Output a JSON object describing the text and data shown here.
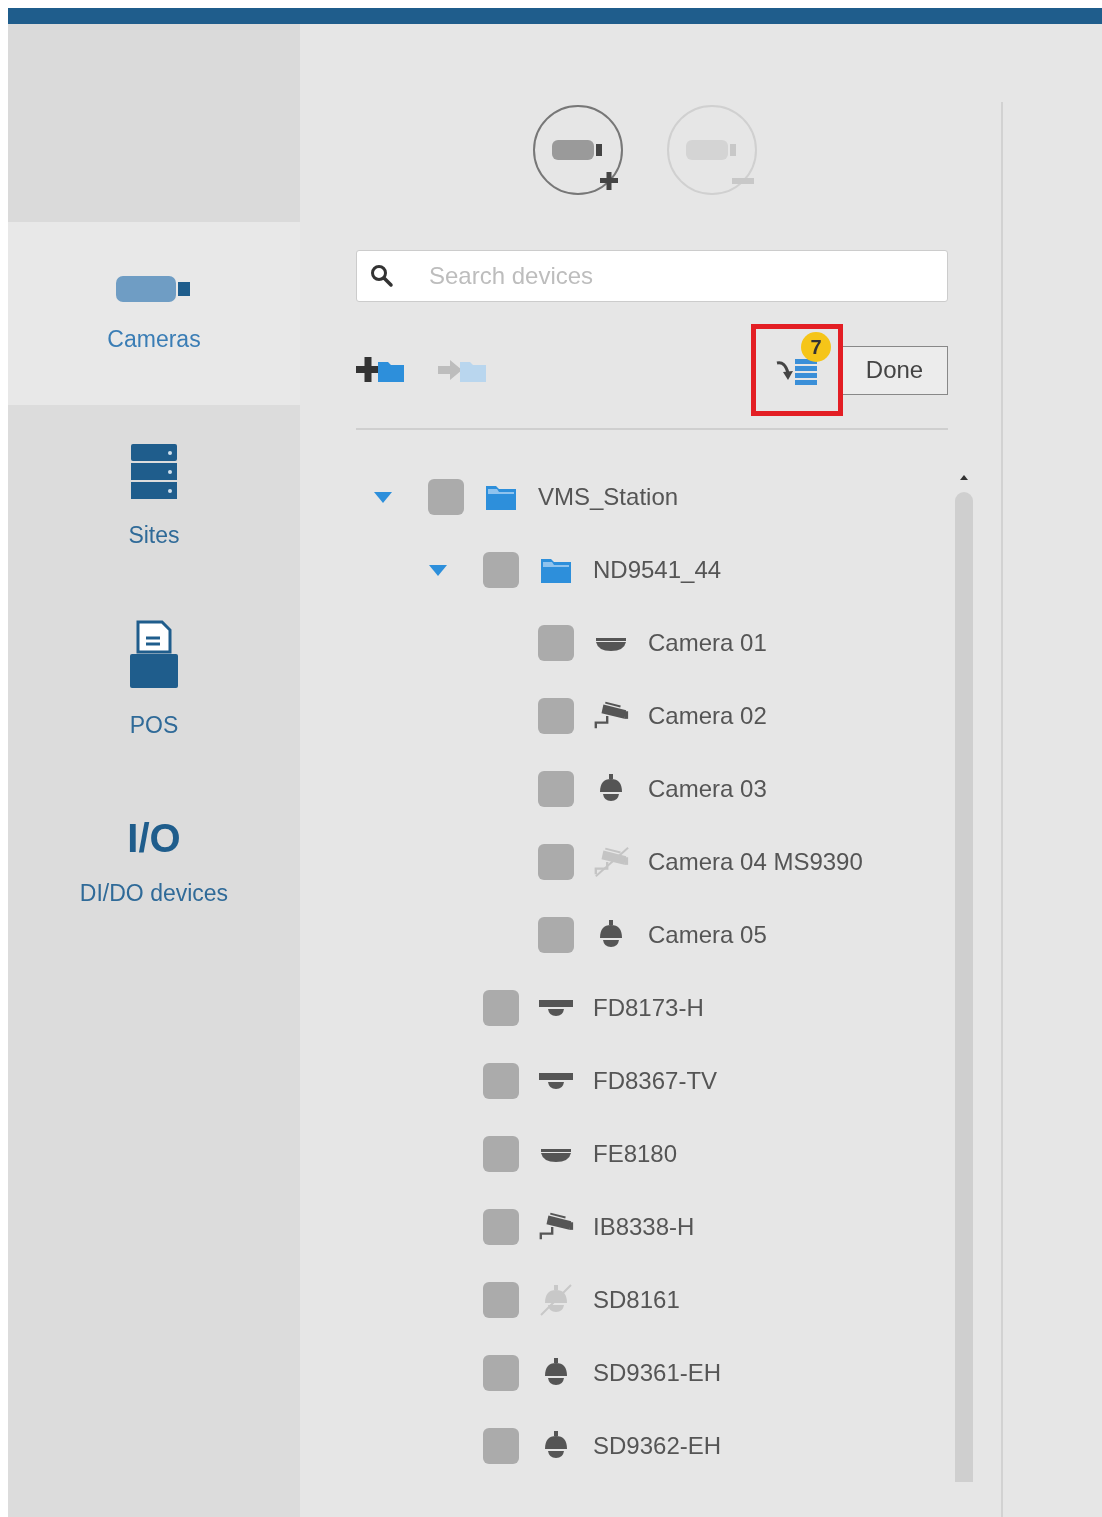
{
  "sidebar": {
    "items": [
      {
        "label": "Cameras",
        "kind": "camera",
        "selected": true
      },
      {
        "label": "Sites",
        "kind": "server",
        "selected": false
      },
      {
        "label": "POS",
        "kind": "pos",
        "selected": false
      },
      {
        "label": "DI/DO devices",
        "kind": "io",
        "glyph": "I/O",
        "selected": false
      }
    ]
  },
  "camera_buttons": [
    {
      "kind": "add",
      "disabled": false
    },
    {
      "kind": "remove",
      "disabled": true
    }
  ],
  "search": {
    "placeholder": "Search devices"
  },
  "toolbar": {
    "tools": [
      {
        "kind": "add-folder",
        "disabled": false
      },
      {
        "kind": "move-to-folder",
        "disabled": true
      }
    ],
    "import_button": {
      "badge": "7",
      "highlighted": true
    },
    "done_button": "Done"
  },
  "tree": [
    {
      "label": "VMS_Station",
      "kind": "folder",
      "expanded": true,
      "checked": false,
      "children": [
        {
          "label": "ND9541_44",
          "kind": "folder",
          "expanded": true,
          "checked": false,
          "children": [
            {
              "label": "Camera 01",
              "kind": "fisheye",
              "checked": false
            },
            {
              "label": "Camera 02",
              "kind": "bullet",
              "checked": false
            },
            {
              "label": "Camera 03",
              "kind": "speed-dome",
              "checked": false
            },
            {
              "label": "Camera 04 MS9390",
              "kind": "bullet-offline",
              "checked": false
            },
            {
              "label": "Camera 05",
              "kind": "speed-dome",
              "checked": false
            }
          ]
        },
        {
          "label": "FD8173-H",
          "kind": "dome",
          "checked": false
        },
        {
          "label": "FD8367-TV",
          "kind": "dome",
          "checked": false
        },
        {
          "label": "FE8180",
          "kind": "fisheye",
          "checked": false
        },
        {
          "label": "IB8338-H",
          "kind": "bullet",
          "checked": false
        },
        {
          "label": "SD8161",
          "kind": "speed-dome-offline",
          "checked": false
        },
        {
          "label": "SD9361-EH",
          "kind": "speed-dome",
          "checked": false
        },
        {
          "label": "SD9362-EH",
          "kind": "speed-dome",
          "checked": false
        }
      ]
    }
  ]
}
